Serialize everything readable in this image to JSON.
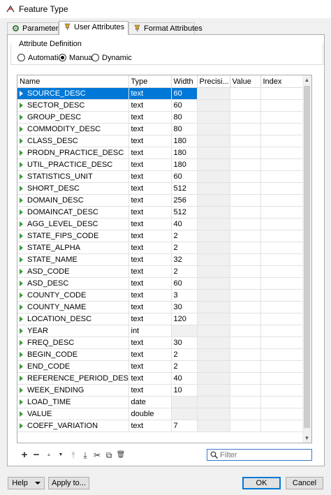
{
  "window": {
    "title": "Feature Type"
  },
  "tabs": [
    {
      "label": "Parameters",
      "icon": "gear-icon"
    },
    {
      "label": "User Attributes",
      "icon": "pin-icon"
    },
    {
      "label": "Format Attributes",
      "icon": "pin-icon"
    }
  ],
  "attribute_definition": {
    "label": "Attribute Definition",
    "options": [
      "Automatic",
      "Manual",
      "Dynamic"
    ],
    "selected": "Manual"
  },
  "table": {
    "columns": [
      "Name",
      "Type",
      "Width",
      "Precisi...",
      "Value",
      "Index"
    ],
    "rows": [
      {
        "name": "SOURCE_DESC",
        "type": "text",
        "width": "60"
      },
      {
        "name": "SECTOR_DESC",
        "type": "text",
        "width": "60"
      },
      {
        "name": "GROUP_DESC",
        "type": "text",
        "width": "80"
      },
      {
        "name": "COMMODITY_DESC",
        "type": "text",
        "width": "80"
      },
      {
        "name": "CLASS_DESC",
        "type": "text",
        "width": "180"
      },
      {
        "name": "PRODN_PRACTICE_DESC",
        "type": "text",
        "width": "180"
      },
      {
        "name": "UTIL_PRACTICE_DESC",
        "type": "text",
        "width": "180"
      },
      {
        "name": "STATISTICS_UNIT",
        "type": "text",
        "width": "60"
      },
      {
        "name": "SHORT_DESC",
        "type": "text",
        "width": "512"
      },
      {
        "name": "DOMAIN_DESC",
        "type": "text",
        "width": "256"
      },
      {
        "name": "DOMAINCAT_DESC",
        "type": "text",
        "width": "512"
      },
      {
        "name": "AGG_LEVEL_DESC",
        "type": "text",
        "width": "40"
      },
      {
        "name": "STATE_FIPS_CODE",
        "type": "text",
        "width": "2"
      },
      {
        "name": "STATE_ALPHA",
        "type": "text",
        "width": "2"
      },
      {
        "name": "STATE_NAME",
        "type": "text",
        "width": "32"
      },
      {
        "name": "ASD_CODE",
        "type": "text",
        "width": "2"
      },
      {
        "name": "ASD_DESC",
        "type": "text",
        "width": "60"
      },
      {
        "name": "COUNTY_CODE",
        "type": "text",
        "width": "3"
      },
      {
        "name": "COUNTY_NAME",
        "type": "text",
        "width": "30"
      },
      {
        "name": "LOCATION_DESC",
        "type": "text",
        "width": "120"
      },
      {
        "name": "YEAR",
        "type": "int",
        "width": ""
      },
      {
        "name": "FREQ_DESC",
        "type": "text",
        "width": "30"
      },
      {
        "name": "BEGIN_CODE",
        "type": "text",
        "width": "2"
      },
      {
        "name": "END_CODE",
        "type": "text",
        "width": "2"
      },
      {
        "name": "REFERENCE_PERIOD_DESC",
        "type": "text",
        "width": "40"
      },
      {
        "name": "WEEK_ENDING",
        "type": "text",
        "width": "10"
      },
      {
        "name": "LOAD_TIME",
        "type": "date",
        "width": ""
      },
      {
        "name": "VALUE",
        "type": "double",
        "width": ""
      },
      {
        "name": "COEFF_VARIATION",
        "type": "text",
        "width": "7"
      }
    ],
    "selected_index": 0
  },
  "toolbar": {
    "add": "+",
    "remove": "−",
    "move_up": "▲",
    "move_down": "▼",
    "move_top": "⤒",
    "move_bottom": "⤓",
    "cut": "✂",
    "copy": "⧉",
    "delete": "🗑"
  },
  "filter": {
    "placeholder": "Filter",
    "value": ""
  },
  "buttons": {
    "help": "Help",
    "apply_to": "Apply to...",
    "ok": "OK",
    "cancel": "Cancel"
  }
}
